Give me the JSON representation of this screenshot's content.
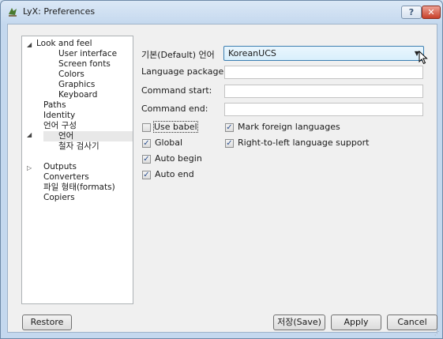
{
  "window": {
    "title": "LyX: Preferences",
    "help_glyph": "?",
    "close_glyph": "✕"
  },
  "tree": [
    {
      "label": "Look and feel",
      "expanded": true
    },
    {
      "label": "User interface"
    },
    {
      "label": "Screen fonts"
    },
    {
      "label": "Colors"
    },
    {
      "label": "Graphics"
    },
    {
      "label": "Keyboard"
    },
    {
      "label": "Paths"
    },
    {
      "label": "Identity"
    },
    {
      "label": "언어 구성",
      "expanded": true
    },
    {
      "label": "언어",
      "selected": true
    },
    {
      "label": "철자 검사기"
    },
    {
      "label": "Outputs",
      "expanded": false
    },
    {
      "label": "Converters"
    },
    {
      "label": "파일 형태(formats)"
    },
    {
      "label": "Copiers"
    }
  ],
  "form": {
    "default_language_label": "기본(Default) 언어",
    "default_language_value": "KoreanUCS",
    "language_package_label": "Language package:",
    "language_package_value": "",
    "command_start_label": "Command start:",
    "command_start_value": "",
    "command_end_label": "Command end:",
    "command_end_value": ""
  },
  "checks": {
    "use_babel": {
      "label": "Use babel",
      "checked": false
    },
    "global": {
      "label": "Global",
      "checked": true
    },
    "auto_begin": {
      "label": "Auto begin",
      "checked": true
    },
    "auto_end": {
      "label": "Auto end",
      "checked": true
    },
    "mark_foreign": {
      "label": "Mark foreign languages",
      "checked": true
    },
    "rtl_support": {
      "label": "Right-to-left language support",
      "checked": true
    }
  },
  "buttons": {
    "restore": "Restore",
    "save": "저장(Save)",
    "apply": "Apply",
    "cancel": "Cancel"
  },
  "glyphs": {
    "expanded": "◢",
    "collapsed": "▷",
    "check": "✓",
    "dropdown": "▼",
    "resize": "⋰"
  },
  "colors": {
    "title_gradient": "#c4d8ee",
    "close_red": "#c7402a",
    "combo_border": "#3c7fb1"
  }
}
